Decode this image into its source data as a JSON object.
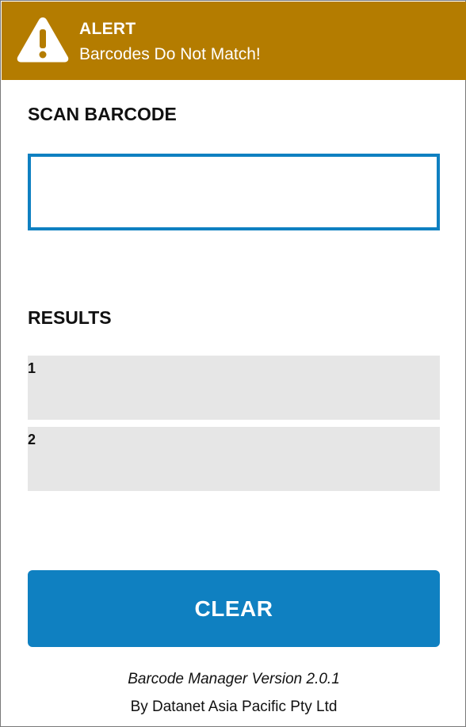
{
  "alert": {
    "title": "ALERT",
    "message": "Barcodes Do Not Match!",
    "icon": "warning-triangle-icon",
    "background_color": "#b47c00"
  },
  "scan": {
    "heading": "SCAN BARCODE",
    "value": "",
    "placeholder": ""
  },
  "results": {
    "heading": "RESULTS",
    "items": [
      {
        "index": "1",
        "value": ""
      },
      {
        "index": "2",
        "value": ""
      }
    ]
  },
  "actions": {
    "clear_label": "CLEAR"
  },
  "footer": {
    "version": "Barcode Manager Version 2.0.1",
    "company": "By Datanet Asia Pacific Pty Ltd"
  },
  "colors": {
    "accent": "#0f80c1",
    "row_background": "#e6e6e6"
  }
}
